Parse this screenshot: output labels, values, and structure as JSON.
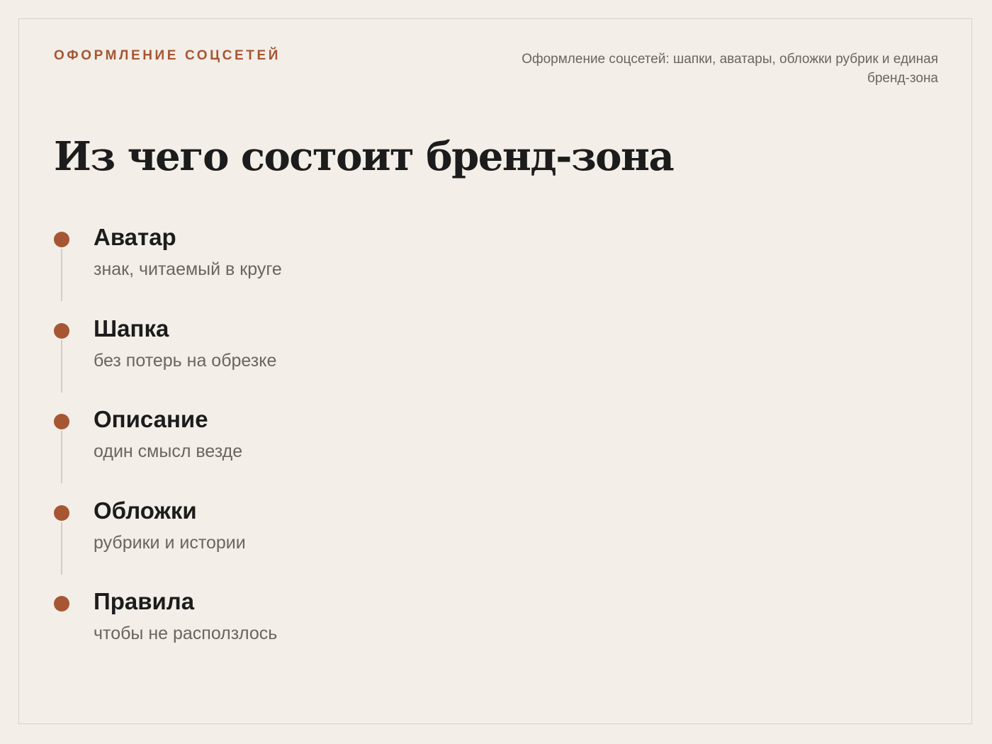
{
  "header": {
    "eyebrow": "ОФОРМЛЕНИЕ СОЦСЕТЕЙ",
    "subtitle": "Оформление соцсетей: шапки, аватары, обложки рубрик и единая бренд-зона"
  },
  "main": {
    "title": "Из чего состоит бренд-зона",
    "items": [
      {
        "title": "Аватар",
        "description": "знак, читаемый в круге"
      },
      {
        "title": "Шапка",
        "description": "без потерь на обрезке"
      },
      {
        "title": "Описание",
        "description": "один смысл везде"
      },
      {
        "title": "Обложки",
        "description": "рубрики и истории"
      },
      {
        "title": "Правила",
        "description": "чтобы не расползлось"
      }
    ]
  },
  "colors": {
    "background": "#f3eee8",
    "accent": "#a65633",
    "text": "#1c1c1c",
    "muted": "#6b6560"
  }
}
